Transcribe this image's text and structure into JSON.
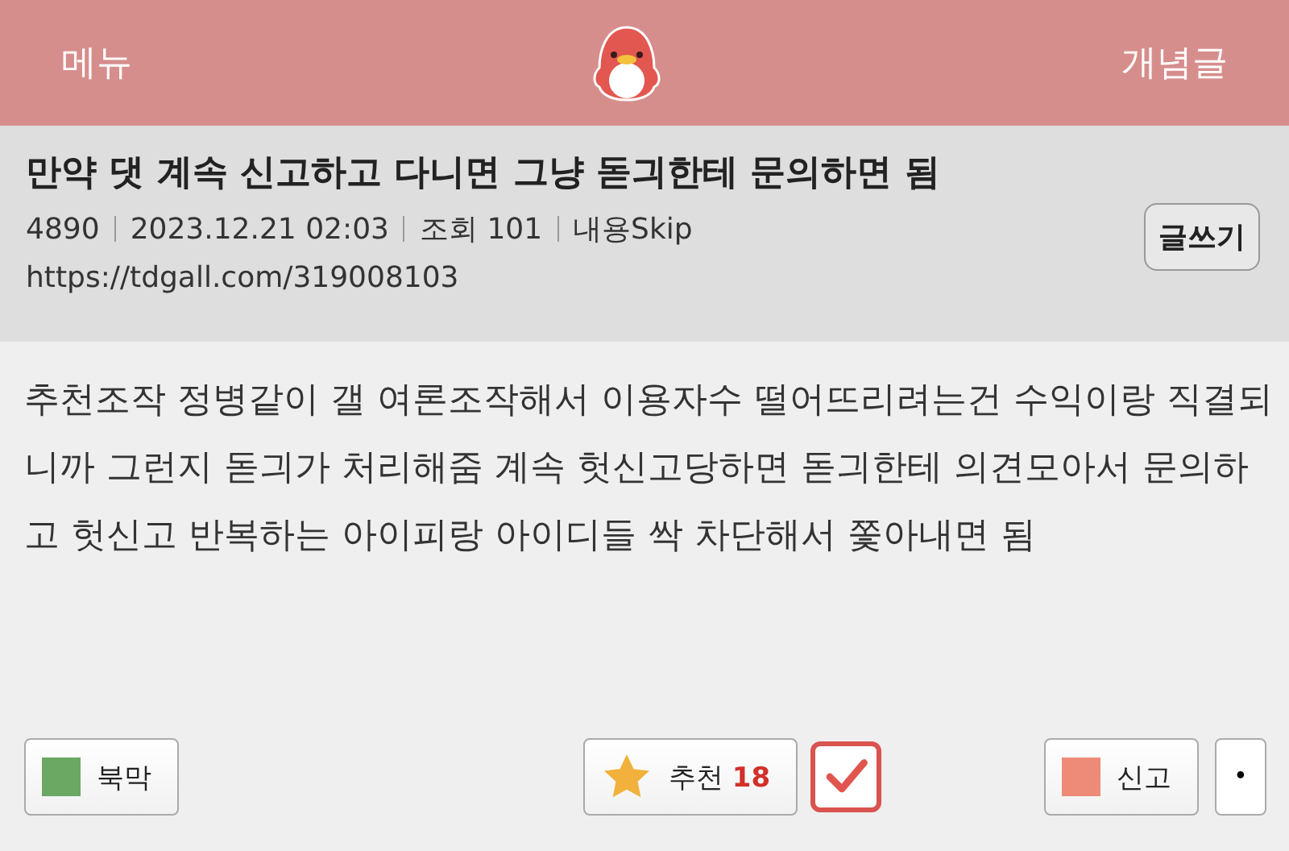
{
  "header": {
    "menu": "메뉴",
    "concept": "개념글"
  },
  "post": {
    "title": "만약 댓 계속 신고하고 다니면 그냥 돋긔한테 문의하면 됨",
    "meta": [
      "4890",
      "2023.12.21 02:03",
      "조회 101",
      "내용Skip"
    ],
    "url": "https://tdgall.com/319008103",
    "write_button": "글쓰기"
  },
  "body": "추천조작 정병같이 갤 여론조작해서 이용자수 떨어뜨리려는건 수익이랑 직결되니까 그런지 돋긔가 처리해줌 계속 헛신고당하면 돋긔한테 의견모아서 문의하고 헛신고 반복하는 아이피랑 아이디들 싹 차단해서 쫓아내면 됨",
  "actions": {
    "bookmark": {
      "label": "북막",
      "color": "#6aa864"
    },
    "recommend": {
      "label": "추천",
      "count": "18",
      "checked": true
    },
    "report": {
      "label": "신고",
      "color": "#ee8a78"
    },
    "more": "•"
  }
}
